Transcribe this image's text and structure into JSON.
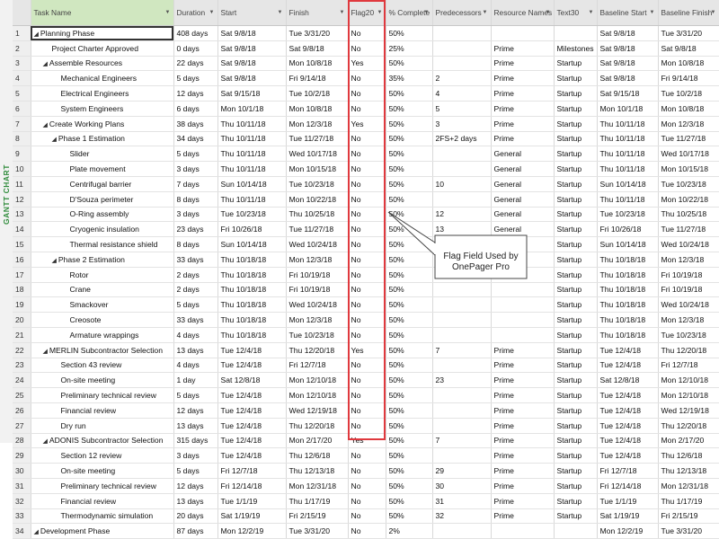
{
  "sidebar_label": "GANTT CHART",
  "columns": [
    "Task Name",
    "Duration",
    "Start",
    "Finish",
    "Flag20",
    "% Complete",
    "Predecessors",
    "Resource Names",
    "Text30",
    "Baseline Start",
    "Baseline Finish"
  ],
  "callout": {
    "line1": "Flag Field Used by",
    "line2": "OnePager Pro"
  },
  "colors": {
    "highlight": "#e0393e",
    "task_header": "#d0e7c0",
    "sidebar_text": "#2e8b3a"
  },
  "rows": [
    {
      "id": "1",
      "level": 0,
      "summary": true,
      "selected": true,
      "name": "Planning Phase",
      "duration": "408 days",
      "start": "Sat 9/8/18",
      "finish": "Tue 3/31/20",
      "flag": "No",
      "pct": "50%",
      "pred": "",
      "res": "",
      "text30": "",
      "bstart": "Sat 9/8/18",
      "bfinish": "Tue 3/31/20"
    },
    {
      "id": "2",
      "level": 1,
      "summary": false,
      "name": "Project Charter Approved",
      "duration": "0 days",
      "start": "Sat 9/8/18",
      "finish": "Sat 9/8/18",
      "flag": "No",
      "pct": "25%",
      "pred": "",
      "res": "Prime",
      "text30": "Milestones",
      "bstart": "Sat 9/8/18",
      "bfinish": "Sat 9/8/18"
    },
    {
      "id": "3",
      "level": 1,
      "summary": true,
      "name": "Assemble Resources",
      "duration": "22 days",
      "start": "Sat 9/8/18",
      "finish": "Mon 10/8/18",
      "flag": "Yes",
      "pct": "50%",
      "pred": "",
      "res": "Prime",
      "text30": "Startup",
      "bstart": "Sat 9/8/18",
      "bfinish": "Mon 10/8/18"
    },
    {
      "id": "4",
      "level": 2,
      "summary": false,
      "name": "Mechanical Engineers",
      "duration": "5 days",
      "start": "Sat 9/8/18",
      "finish": "Fri 9/14/18",
      "flag": "No",
      "pct": "35%",
      "pred": "2",
      "res": "Prime",
      "text30": "Startup",
      "bstart": "Sat 9/8/18",
      "bfinish": "Fri 9/14/18"
    },
    {
      "id": "5",
      "level": 2,
      "summary": false,
      "name": "Electrical Engineers",
      "duration": "12 days",
      "start": "Sat 9/15/18",
      "finish": "Tue 10/2/18",
      "flag": "No",
      "pct": "50%",
      "pred": "4",
      "res": "Prime",
      "text30": "Startup",
      "bstart": "Sat 9/15/18",
      "bfinish": "Tue 10/2/18"
    },
    {
      "id": "6",
      "level": 2,
      "summary": false,
      "name": "System Engineers",
      "duration": "6 days",
      "start": "Mon 10/1/18",
      "finish": "Mon 10/8/18",
      "flag": "No",
      "pct": "50%",
      "pred": "5",
      "res": "Prime",
      "text30": "Startup",
      "bstart": "Mon 10/1/18",
      "bfinish": "Mon 10/8/18"
    },
    {
      "id": "7",
      "level": 1,
      "summary": true,
      "name": "Create Working Plans",
      "duration": "38 days",
      "start": "Thu 10/11/18",
      "finish": "Mon 12/3/18",
      "flag": "Yes",
      "pct": "50%",
      "pred": "3",
      "res": "Prime",
      "text30": "Startup",
      "bstart": "Thu 10/11/18",
      "bfinish": "Mon 12/3/18"
    },
    {
      "id": "8",
      "level": 2,
      "summary": true,
      "name": "Phase 1 Estimation",
      "duration": "34 days",
      "start": "Thu 10/11/18",
      "finish": "Tue 11/27/18",
      "flag": "No",
      "pct": "50%",
      "pred": "2FS+2 days",
      "res": "Prime",
      "text30": "Startup",
      "bstart": "Thu 10/11/18",
      "bfinish": "Tue 11/27/18"
    },
    {
      "id": "9",
      "level": 3,
      "summary": false,
      "name": "Slider",
      "duration": "5 days",
      "start": "Thu 10/11/18",
      "finish": "Wed 10/17/18",
      "flag": "No",
      "pct": "50%",
      "pred": "",
      "res": "General",
      "text30": "Startup",
      "bstart": "Thu 10/11/18",
      "bfinish": "Wed 10/17/18"
    },
    {
      "id": "10",
      "level": 3,
      "summary": false,
      "name": "Plate movement",
      "duration": "3 days",
      "start": "Thu 10/11/18",
      "finish": "Mon 10/15/18",
      "flag": "No",
      "pct": "50%",
      "pred": "",
      "res": "General",
      "text30": "Startup",
      "bstart": "Thu 10/11/18",
      "bfinish": "Mon 10/15/18"
    },
    {
      "id": "11",
      "level": 3,
      "summary": false,
      "name": "Centrifugal barrier",
      "duration": "7 days",
      "start": "Sun 10/14/18",
      "finish": "Tue 10/23/18",
      "flag": "No",
      "pct": "50%",
      "pred": "10",
      "res": "General",
      "text30": "Startup",
      "bstart": "Sun 10/14/18",
      "bfinish": "Tue 10/23/18"
    },
    {
      "id": "12",
      "level": 3,
      "summary": false,
      "name": "D'Souza perimeter",
      "duration": "8 days",
      "start": "Thu 10/11/18",
      "finish": "Mon 10/22/18",
      "flag": "No",
      "pct": "50%",
      "pred": "",
      "res": "General",
      "text30": "Startup",
      "bstart": "Thu 10/11/18",
      "bfinish": "Mon 10/22/18"
    },
    {
      "id": "13",
      "level": 3,
      "summary": false,
      "name": "O-Ring assembly",
      "duration": "3 days",
      "start": "Tue 10/23/18",
      "finish": "Thu 10/25/18",
      "flag": "No",
      "pct": "50%",
      "pred": "12",
      "res": "General",
      "text30": "Startup",
      "bstart": "Tue 10/23/18",
      "bfinish": "Thu 10/25/18"
    },
    {
      "id": "14",
      "level": 3,
      "summary": false,
      "name": "Cryogenic insulation",
      "duration": "23 days",
      "start": "Fri 10/26/18",
      "finish": "Tue 11/27/18",
      "flag": "No",
      "pct": "50%",
      "pred": "13",
      "res": "General",
      "text30": "Startup",
      "bstart": "Fri 10/26/18",
      "bfinish": "Tue 11/27/18"
    },
    {
      "id": "15",
      "level": 3,
      "summary": false,
      "name": "Thermal resistance shield",
      "duration": "8 days",
      "start": "Sun 10/14/18",
      "finish": "Wed 10/24/18",
      "flag": "No",
      "pct": "50%",
      "pred": "11",
      "res": "General",
      "text30": "Startup",
      "bstart": "Sun 10/14/18",
      "bfinish": "Wed 10/24/18"
    },
    {
      "id": "16",
      "level": 2,
      "summary": true,
      "name": "Phase 2 Estimation",
      "duration": "33 days",
      "start": "Thu 10/18/18",
      "finish": "Mon 12/3/18",
      "flag": "No",
      "pct": "50%",
      "pred": "9",
      "res": "Prime",
      "text30": "Startup",
      "bstart": "Thu 10/18/18",
      "bfinish": "Mon 12/3/18"
    },
    {
      "id": "17",
      "level": 3,
      "summary": false,
      "name": "Rotor",
      "duration": "2 days",
      "start": "Thu 10/18/18",
      "finish": "Fri 10/19/18",
      "flag": "No",
      "pct": "50%",
      "pred": "",
      "res": "Prime",
      "text30": "Startup",
      "bstart": "Thu 10/18/18",
      "bfinish": "Fri 10/19/18"
    },
    {
      "id": "18",
      "level": 3,
      "summary": false,
      "name": "Crane",
      "duration": "2 days",
      "start": "Thu 10/18/18",
      "finish": "Fri 10/19/18",
      "flag": "No",
      "pct": "50%",
      "pred": "",
      "res": "",
      "text30": "Startup",
      "bstart": "Thu 10/18/18",
      "bfinish": "Fri 10/19/18"
    },
    {
      "id": "19",
      "level": 3,
      "summary": false,
      "name": "Smackover",
      "duration": "5 days",
      "start": "Thu 10/18/18",
      "finish": "Wed 10/24/18",
      "flag": "No",
      "pct": "50%",
      "pred": "",
      "res": "",
      "text30": "Startup",
      "bstart": "Thu 10/18/18",
      "bfinish": "Wed 10/24/18"
    },
    {
      "id": "20",
      "level": 3,
      "summary": false,
      "name": "Creosote",
      "duration": "33 days",
      "start": "Thu 10/18/18",
      "finish": "Mon 12/3/18",
      "flag": "No",
      "pct": "50%",
      "pred": "",
      "res": "",
      "text30": "Startup",
      "bstart": "Thu 10/18/18",
      "bfinish": "Mon 12/3/18"
    },
    {
      "id": "21",
      "level": 3,
      "summary": false,
      "name": "Armature wrappings",
      "duration": "4 days",
      "start": "Thu 10/18/18",
      "finish": "Tue 10/23/18",
      "flag": "No",
      "pct": "50%",
      "pred": "",
      "res": "",
      "text30": "Startup",
      "bstart": "Thu 10/18/18",
      "bfinish": "Tue 10/23/18"
    },
    {
      "id": "22",
      "level": 1,
      "summary": true,
      "name": "MERLIN Subcontractor Selection",
      "duration": "13 days",
      "start": "Tue 12/4/18",
      "finish": "Thu 12/20/18",
      "flag": "Yes",
      "pct": "50%",
      "pred": "7",
      "res": "Prime",
      "text30": "Startup",
      "bstart": "Tue 12/4/18",
      "bfinish": "Thu 12/20/18"
    },
    {
      "id": "23",
      "level": 2,
      "summary": false,
      "name": "Section 43 review",
      "duration": "4 days",
      "start": "Tue 12/4/18",
      "finish": "Fri 12/7/18",
      "flag": "No",
      "pct": "50%",
      "pred": "",
      "res": "Prime",
      "text30": "Startup",
      "bstart": "Tue 12/4/18",
      "bfinish": "Fri 12/7/18"
    },
    {
      "id": "24",
      "level": 2,
      "summary": false,
      "name": "On-site meeting",
      "duration": "1 day",
      "start": "Sat 12/8/18",
      "finish": "Mon 12/10/18",
      "flag": "No",
      "pct": "50%",
      "pred": "23",
      "res": "Prime",
      "text30": "Startup",
      "bstart": "Sat 12/8/18",
      "bfinish": "Mon 12/10/18"
    },
    {
      "id": "25",
      "level": 2,
      "summary": false,
      "name": "Preliminary technical review",
      "duration": "5 days",
      "start": "Tue 12/4/18",
      "finish": "Mon 12/10/18",
      "flag": "No",
      "pct": "50%",
      "pred": "",
      "res": "Prime",
      "text30": "Startup",
      "bstart": "Tue 12/4/18",
      "bfinish": "Mon 12/10/18"
    },
    {
      "id": "26",
      "level": 2,
      "summary": false,
      "name": "Financial review",
      "duration": "12 days",
      "start": "Tue 12/4/18",
      "finish": "Wed 12/19/18",
      "flag": "No",
      "pct": "50%",
      "pred": "",
      "res": "Prime",
      "text30": "Startup",
      "bstart": "Tue 12/4/18",
      "bfinish": "Wed 12/19/18"
    },
    {
      "id": "27",
      "level": 2,
      "summary": false,
      "name": "Dry run",
      "duration": "13 days",
      "start": "Tue 12/4/18",
      "finish": "Thu 12/20/18",
      "flag": "No",
      "pct": "50%",
      "pred": "",
      "res": "Prime",
      "text30": "Startup",
      "bstart": "Tue 12/4/18",
      "bfinish": "Thu 12/20/18"
    },
    {
      "id": "28",
      "level": 1,
      "summary": true,
      "name": "ADONIS Subcontractor Selection",
      "duration": "315 days",
      "start": "Tue 12/4/18",
      "finish": "Mon 2/17/20",
      "flag": "Yes",
      "pct": "50%",
      "pred": "7",
      "res": "Prime",
      "text30": "Startup",
      "bstart": "Tue 12/4/18",
      "bfinish": "Mon 2/17/20"
    },
    {
      "id": "29",
      "level": 2,
      "summary": false,
      "name": "Section 12 review",
      "duration": "3 days",
      "start": "Tue 12/4/18",
      "finish": "Thu 12/6/18",
      "flag": "No",
      "pct": "50%",
      "pred": "",
      "res": "Prime",
      "text30": "Startup",
      "bstart": "Tue 12/4/18",
      "bfinish": "Thu 12/6/18"
    },
    {
      "id": "30",
      "level": 2,
      "summary": false,
      "name": "On-site meeting",
      "duration": "5 days",
      "start": "Fri 12/7/18",
      "finish": "Thu 12/13/18",
      "flag": "No",
      "pct": "50%",
      "pred": "29",
      "res": "Prime",
      "text30": "Startup",
      "bstart": "Fri 12/7/18",
      "bfinish": "Thu 12/13/18"
    },
    {
      "id": "31",
      "level": 2,
      "summary": false,
      "name": "Preliminary technical review",
      "duration": "12 days",
      "start": "Fri 12/14/18",
      "finish": "Mon 12/31/18",
      "flag": "No",
      "pct": "50%",
      "pred": "30",
      "res": "Prime",
      "text30": "Startup",
      "bstart": "Fri 12/14/18",
      "bfinish": "Mon 12/31/18"
    },
    {
      "id": "32",
      "level": 2,
      "summary": false,
      "name": "Financial review",
      "duration": "13 days",
      "start": "Tue 1/1/19",
      "finish": "Thu 1/17/19",
      "flag": "No",
      "pct": "50%",
      "pred": "31",
      "res": "Prime",
      "text30": "Startup",
      "bstart": "Tue 1/1/19",
      "bfinish": "Thu 1/17/19"
    },
    {
      "id": "33",
      "level": 2,
      "summary": false,
      "name": "Thermodynamic simulation",
      "duration": "20 days",
      "start": "Sat 1/19/19",
      "finish": "Fri 2/15/19",
      "flag": "No",
      "pct": "50%",
      "pred": "32",
      "res": "Prime",
      "text30": "Startup",
      "bstart": "Sat 1/19/19",
      "bfinish": "Fri 2/15/19"
    },
    {
      "id": "34",
      "level": 0,
      "summary": true,
      "name": "Development Phase",
      "duration": "87 days",
      "start": "Mon 12/2/19",
      "finish": "Tue 3/31/20",
      "flag": "No",
      "pct": "2%",
      "pred": "",
      "res": "",
      "text30": "",
      "bstart": "Mon 12/2/19",
      "bfinish": "Tue 3/31/20"
    }
  ]
}
